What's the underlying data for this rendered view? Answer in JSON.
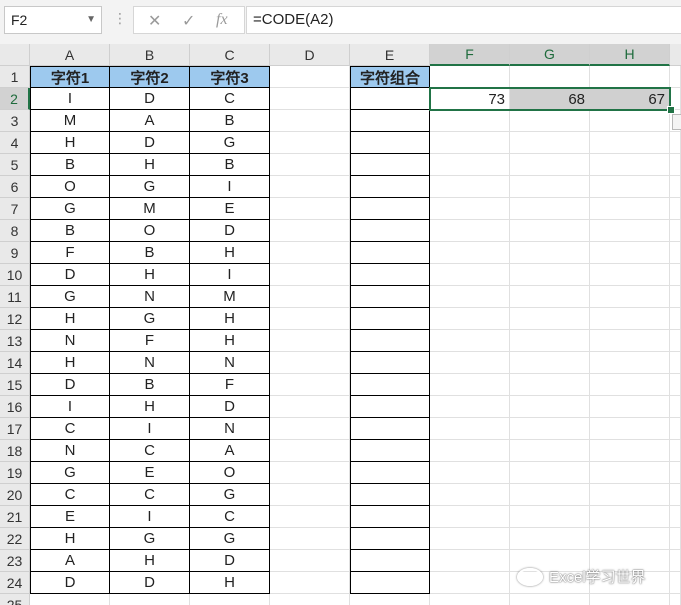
{
  "formula_bar": {
    "name_box": "F2",
    "cancel_icon": "✕",
    "enter_icon": "✓",
    "fx_label": "fx",
    "formula": "=CODE(A2)"
  },
  "columns": [
    "A",
    "B",
    "C",
    "D",
    "E",
    "F",
    "G",
    "H"
  ],
  "rows": [
    "1",
    "2",
    "3",
    "4",
    "5",
    "6",
    "7",
    "8",
    "9",
    "10",
    "11",
    "12",
    "13",
    "14",
    "15",
    "16",
    "17",
    "18",
    "19",
    "20",
    "21",
    "22",
    "23",
    "24",
    "25"
  ],
  "headers": {
    "A1": "字符1",
    "B1": "字符2",
    "C1": "字符3",
    "E1": "字符组合"
  },
  "table": [
    [
      "I",
      "D",
      "C"
    ],
    [
      "M",
      "A",
      "B"
    ],
    [
      "H",
      "D",
      "G"
    ],
    [
      "B",
      "H",
      "B"
    ],
    [
      "O",
      "G",
      "I"
    ],
    [
      "G",
      "M",
      "E"
    ],
    [
      "B",
      "O",
      "D"
    ],
    [
      "F",
      "B",
      "H"
    ],
    [
      "D",
      "H",
      "I"
    ],
    [
      "G",
      "N",
      "M"
    ],
    [
      "H",
      "G",
      "H"
    ],
    [
      "N",
      "F",
      "H"
    ],
    [
      "H",
      "N",
      "N"
    ],
    [
      "D",
      "B",
      "F"
    ],
    [
      "I",
      "H",
      "D"
    ],
    [
      "C",
      "I",
      "N"
    ],
    [
      "N",
      "C",
      "A"
    ],
    [
      "G",
      "E",
      "O"
    ],
    [
      "C",
      "C",
      "G"
    ],
    [
      "E",
      "I",
      "C"
    ],
    [
      "H",
      "G",
      "G"
    ],
    [
      "A",
      "H",
      "D"
    ],
    [
      "D",
      "D",
      "H"
    ]
  ],
  "results": {
    "F2": "73",
    "G2": "68",
    "H2": "67"
  },
  "selected_cell": "F2",
  "colors": {
    "header_fill": "#9dc9ee",
    "highlight_fill": "#d0d0d0",
    "selection": "#217346"
  },
  "watermark": "Excel学习世界"
}
